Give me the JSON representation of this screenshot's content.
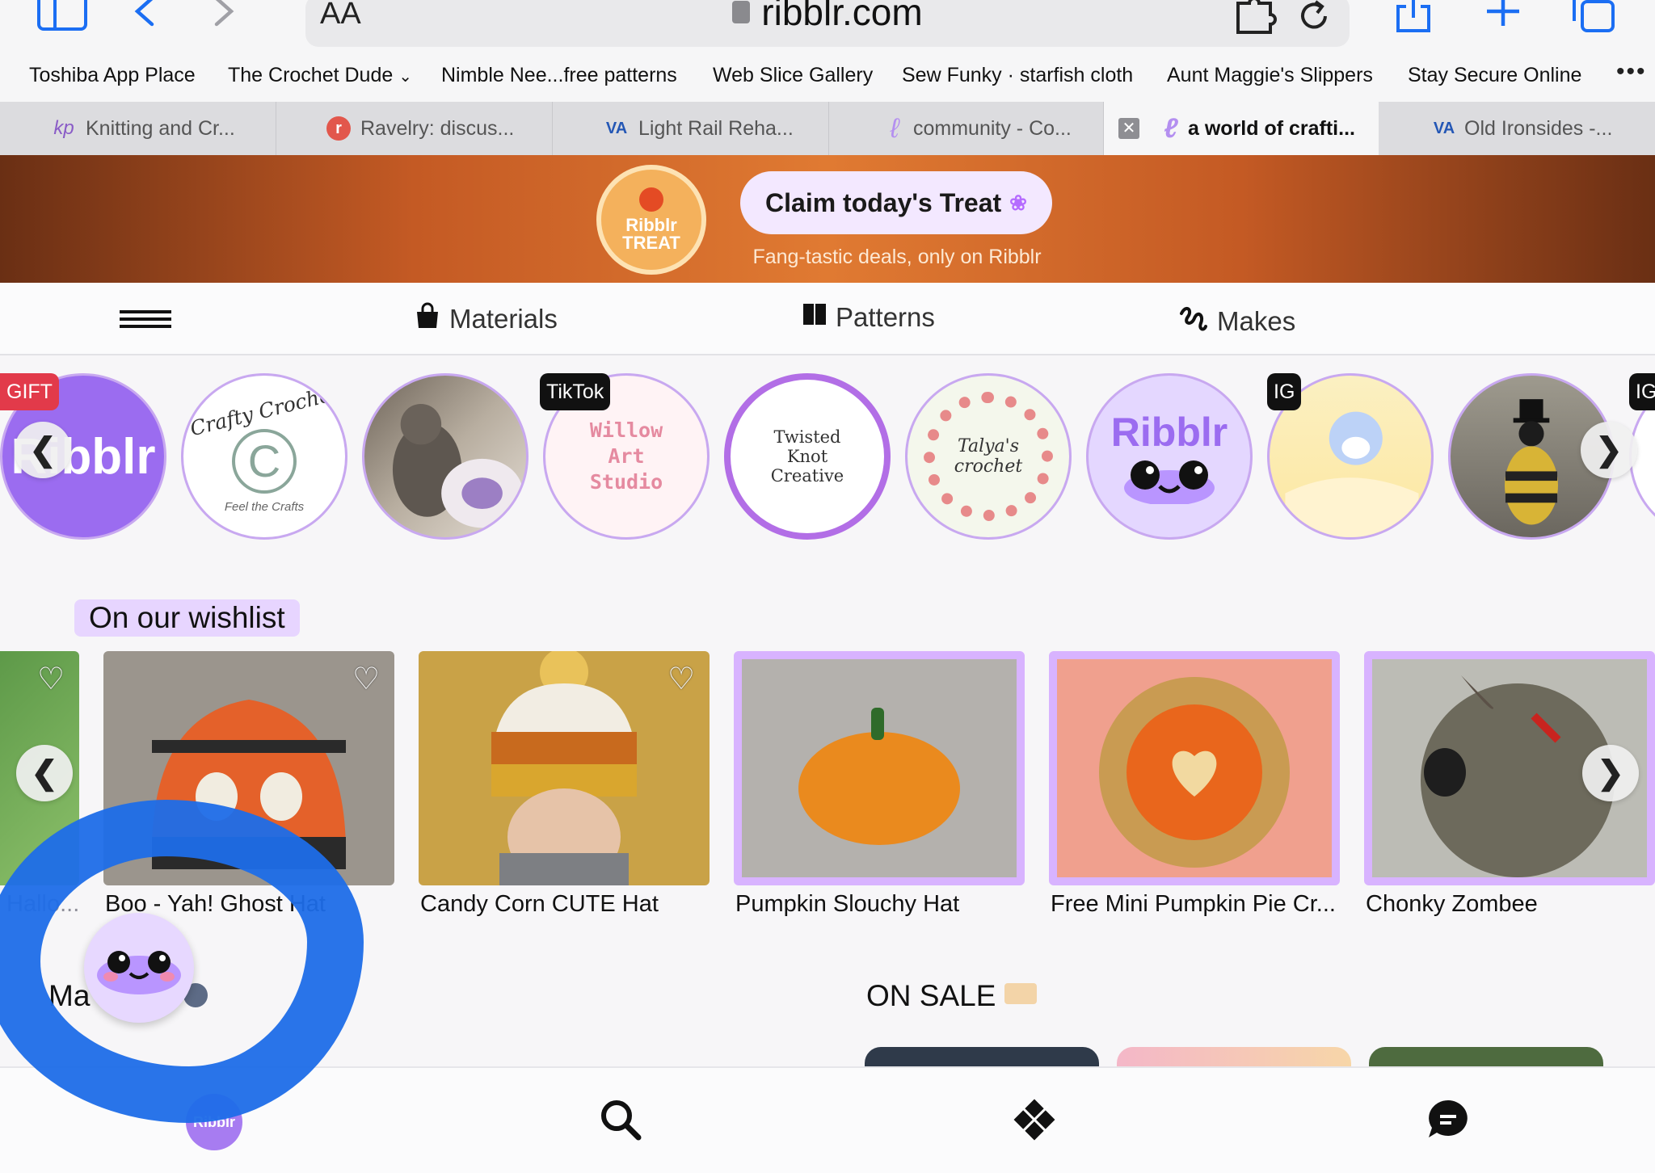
{
  "browser": {
    "text_size_label": "AA",
    "url": "ribblr.com"
  },
  "bookmarks": [
    "Toshiba App Place",
    "The Crochet Dude",
    "Nimble Nee...free patterns",
    "Web Slice Gallery",
    "Sew Funky · starfish cloth",
    "Aunt Maggie's Slippers",
    "Stay Secure Online"
  ],
  "bookmarks_more": "•••",
  "tabs": [
    {
      "title": "Knitting and Cr..."
    },
    {
      "title": "Ravelry: discus..."
    },
    {
      "title": "Light Rail Reha..."
    },
    {
      "title": "community - Co..."
    },
    {
      "title": "a world of crafti..."
    },
    {
      "title": "Old Ironsides -..."
    }
  ],
  "banner": {
    "badge_line1": "Ribblr",
    "badge_line2": "TREAT",
    "claim_label": "Claim today's Treat",
    "subtitle": "Fang-tastic deals, only on Ribblr"
  },
  "nav": {
    "materials": "Materials",
    "patterns": "Patterns",
    "makes": "Makes"
  },
  "stories": {
    "tags": {
      "gift": "GIFT",
      "tiktok": "TikTok",
      "ig1": "IG",
      "ig2": "IG"
    },
    "ribblr_text": "Ribblr",
    "crafty_text": "Crafty Crochet",
    "crafty_sub": "Feel the Crafts",
    "willow_text": "Willow Art Studio",
    "twisted_text": "Twisted Knot Creative",
    "talya_text": "Talya's crochet",
    "ribblr_logo": "Ribblr"
  },
  "wishlist": {
    "title": "On our wishlist",
    "items": [
      {
        "label": "Hallo..."
      },
      {
        "label": "Boo - Yah! Ghost Hat"
      },
      {
        "label": "Candy Corn CUTE Hat"
      },
      {
        "label": "Pumpkin Slouchy Hat"
      },
      {
        "label": "Free Mini Pumpkin Pie Cr..."
      },
      {
        "label": "Chonky Zombee"
      }
    ]
  },
  "sale": {
    "left_title": "Ma SALE",
    "right_title": "ON SALE"
  },
  "bottom_nav": {
    "home_label": "Ribblr"
  },
  "colors": {
    "accent": "#1b6ef3",
    "ribblr_purple": "#9b6cf0",
    "wishlist_highlight": "#e7d5ff",
    "banner_orange": "#e07a32"
  }
}
